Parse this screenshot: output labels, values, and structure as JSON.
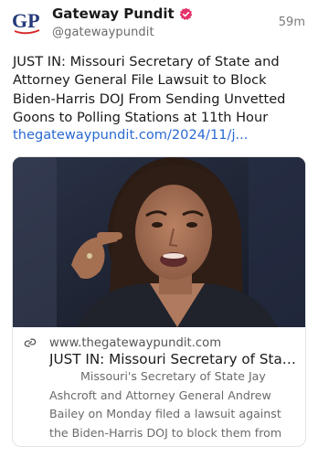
{
  "author": {
    "display_name": "Gateway Pundit",
    "handle": "@gatewaypundit",
    "avatar_text": "GP",
    "verified_icon": "verified-badge-icon",
    "verified_color": "#e4336a"
  },
  "post": {
    "timestamp": "59m",
    "text": "JUST IN: Missouri Secretary of State and\nAttorney General File Lawsuit to Block\nBiden-Harris DOJ From Sending Unvetted\nGoons to Polling Stations at 11th Hour",
    "link_text": "thegatewaypundit.com/2024/11/j...",
    "link_color": "#2a6ad3"
  },
  "link_card": {
    "domain": "www.thegatewaypundit.com",
    "title": "JUST IN: Missouri Secretary of State ...",
    "description": "Missouri's Secretary of State Jay Ashcroft and Attorney General Andrew Bailey on Monday filed a lawsuit against the Biden-Harris DOJ to block them from sendi...",
    "link_icon": "link-icon"
  }
}
